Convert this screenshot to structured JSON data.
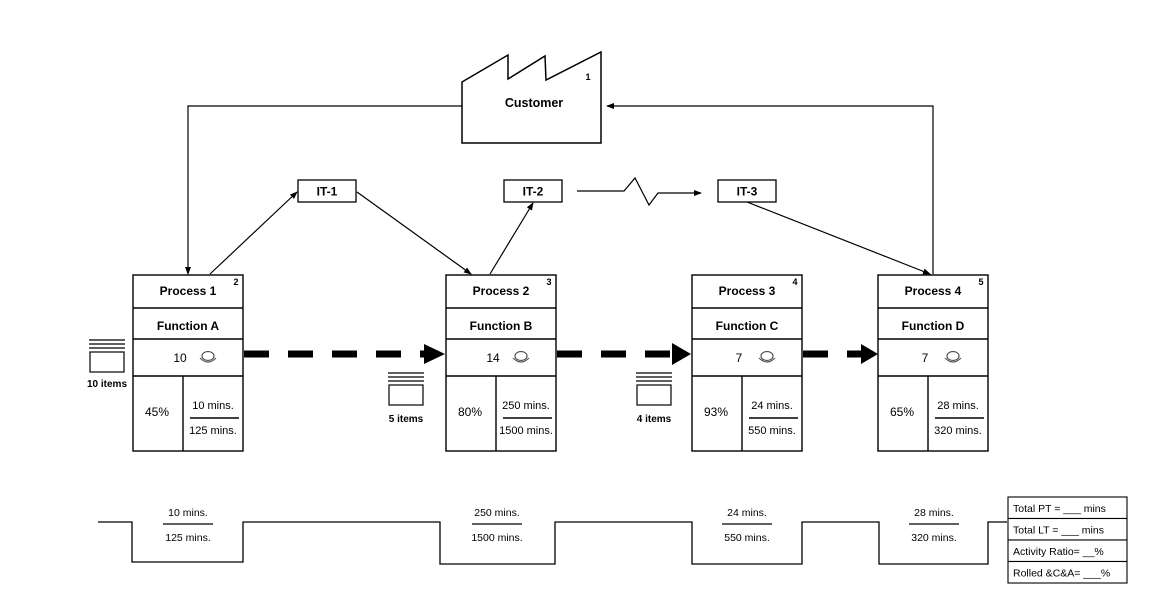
{
  "customer": {
    "label": "Customer",
    "number": "1"
  },
  "info_boxes": [
    {
      "label": "IT-1"
    },
    {
      "label": "IT-2"
    },
    {
      "label": "IT-3"
    }
  ],
  "processes": [
    {
      "name": "Process 1",
      "function": "Function A",
      "number": "2",
      "operators": "10",
      "uptime": "45%",
      "cycle_time": "10 mins.",
      "changeover": "125 mins."
    },
    {
      "name": "Process 2",
      "function": "Function B",
      "number": "3",
      "operators": "14",
      "uptime": "80%",
      "cycle_time": "250 mins.",
      "changeover": "1500 mins."
    },
    {
      "name": "Process 3",
      "function": "Function C",
      "number": "4",
      "operators": "7",
      "uptime": "93%",
      "cycle_time": "24 mins.",
      "changeover": "550 mins."
    },
    {
      "name": "Process 4",
      "function": "Function D",
      "number": "5",
      "operators": "7",
      "uptime": "65%",
      "cycle_time": "28 mins.",
      "changeover": "320 mins."
    }
  ],
  "inventories": [
    {
      "label": "10 items"
    },
    {
      "label": "5 items"
    },
    {
      "label": "4 items"
    }
  ],
  "timeline": [
    {
      "top": "10 mins.",
      "bottom": "125 mins."
    },
    {
      "top": "250 mins.",
      "bottom": "1500 mins."
    },
    {
      "top": "24 mins.",
      "bottom": "550 mins."
    },
    {
      "top": "28 mins.",
      "bottom": "320 mins."
    }
  ],
  "summary": [
    {
      "label": "Total PT = ___ mins"
    },
    {
      "label": "Total LT = ___ mins"
    },
    {
      "label": "Activity Ratio= __%"
    },
    {
      "label": "Rolled &C&A= ___%"
    }
  ],
  "icons": {
    "operator": "operator-icon",
    "inventory": "inventory-icon",
    "push_arrow": "push-arrow-icon",
    "electronic_flow": "electronic-info-flow-icon"
  }
}
